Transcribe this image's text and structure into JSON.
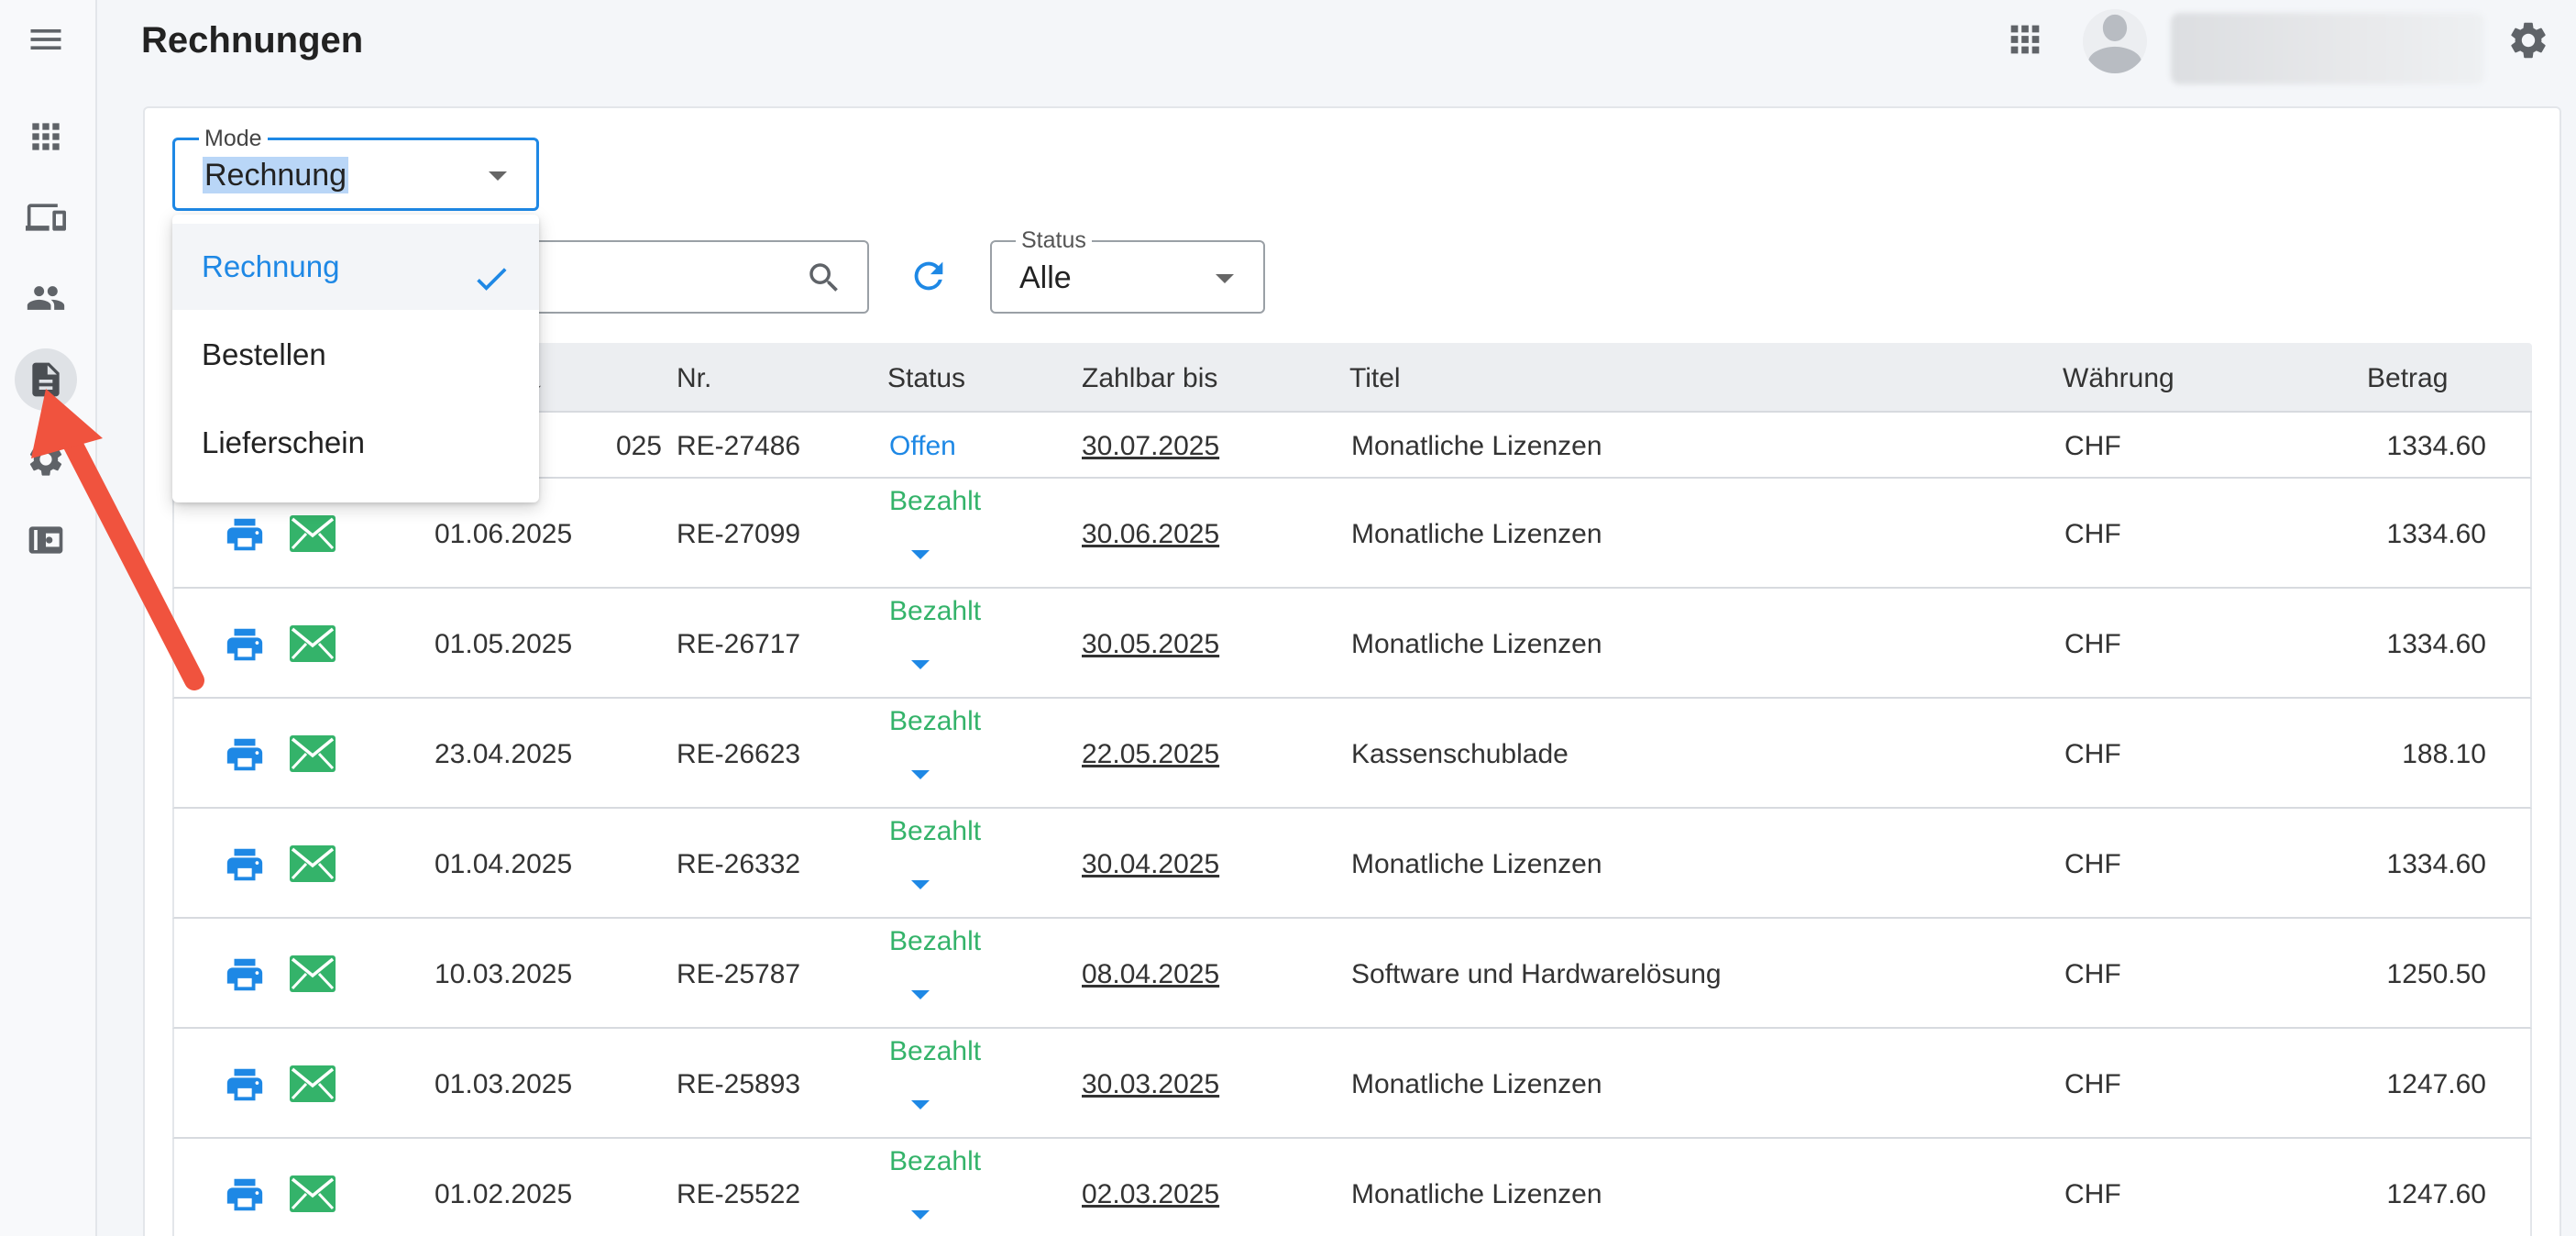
{
  "header": {
    "title": "Rechnungen"
  },
  "mode": {
    "label": "Mode",
    "value": "Rechnung",
    "options": [
      {
        "label": "Rechnung",
        "selected": true
      },
      {
        "label": "Bestellen",
        "selected": false
      },
      {
        "label": "Lieferschein",
        "selected": false
      }
    ]
  },
  "status_filter": {
    "label": "Status",
    "value": "Alle"
  },
  "table": {
    "columns": {
      "date": "",
      "nr": "Nr.",
      "status": "Status",
      "due": "Zahlbar bis",
      "title": "Titel",
      "currency": "Währung",
      "amount": "Betrag"
    },
    "first_row": {
      "date_partial": "025",
      "nr": "RE-27486",
      "status": "Offen",
      "due": "30.07.2025",
      "title": "Monatliche Lizenzen",
      "currency": "CHF",
      "amount": "1334.60"
    },
    "rows": [
      {
        "date": "01.06.2025",
        "nr": "RE-27099",
        "status": "Bezahlt",
        "due": "30.06.2025",
        "title": "Monatliche Lizenzen",
        "currency": "CHF",
        "amount": "1334.60"
      },
      {
        "date": "01.05.2025",
        "nr": "RE-26717",
        "status": "Bezahlt",
        "due": "30.05.2025",
        "title": "Monatliche Lizenzen",
        "currency": "CHF",
        "amount": "1334.60"
      },
      {
        "date": "23.04.2025",
        "nr": "RE-26623",
        "status": "Bezahlt",
        "due": "22.05.2025",
        "title": "Kassenschublade",
        "currency": "CHF",
        "amount": "188.10"
      },
      {
        "date": "01.04.2025",
        "nr": "RE-26332",
        "status": "Bezahlt",
        "due": "30.04.2025",
        "title": "Monatliche Lizenzen",
        "currency": "CHF",
        "amount": "1334.60"
      },
      {
        "date": "10.03.2025",
        "nr": "RE-25787",
        "status": "Bezahlt",
        "due": "08.04.2025",
        "title": "Software und Hardwarelösung",
        "currency": "CHF",
        "amount": "1250.50"
      },
      {
        "date": "01.03.2025",
        "nr": "RE-25893",
        "status": "Bezahlt",
        "due": "30.03.2025",
        "title": "Monatliche Lizenzen",
        "currency": "CHF",
        "amount": "1247.60"
      },
      {
        "date": "01.02.2025",
        "nr": "RE-25522",
        "status": "Bezahlt",
        "due": "02.03.2025",
        "title": "Monatliche Lizenzen",
        "currency": "CHF",
        "amount": "1247.60"
      }
    ]
  },
  "colors": {
    "accent": "#1e88e5",
    "paid": "#34b36a",
    "open": "#1e88e5",
    "annotation": "#f0533e"
  },
  "icons": [
    "menu-icon",
    "apps-icon",
    "devices-icon",
    "people-icon",
    "document-icon",
    "gear-icon",
    "wallet-icon",
    "search-icon",
    "refresh-icon",
    "print-icon",
    "mail-icon",
    "check-icon",
    "avatar"
  ]
}
